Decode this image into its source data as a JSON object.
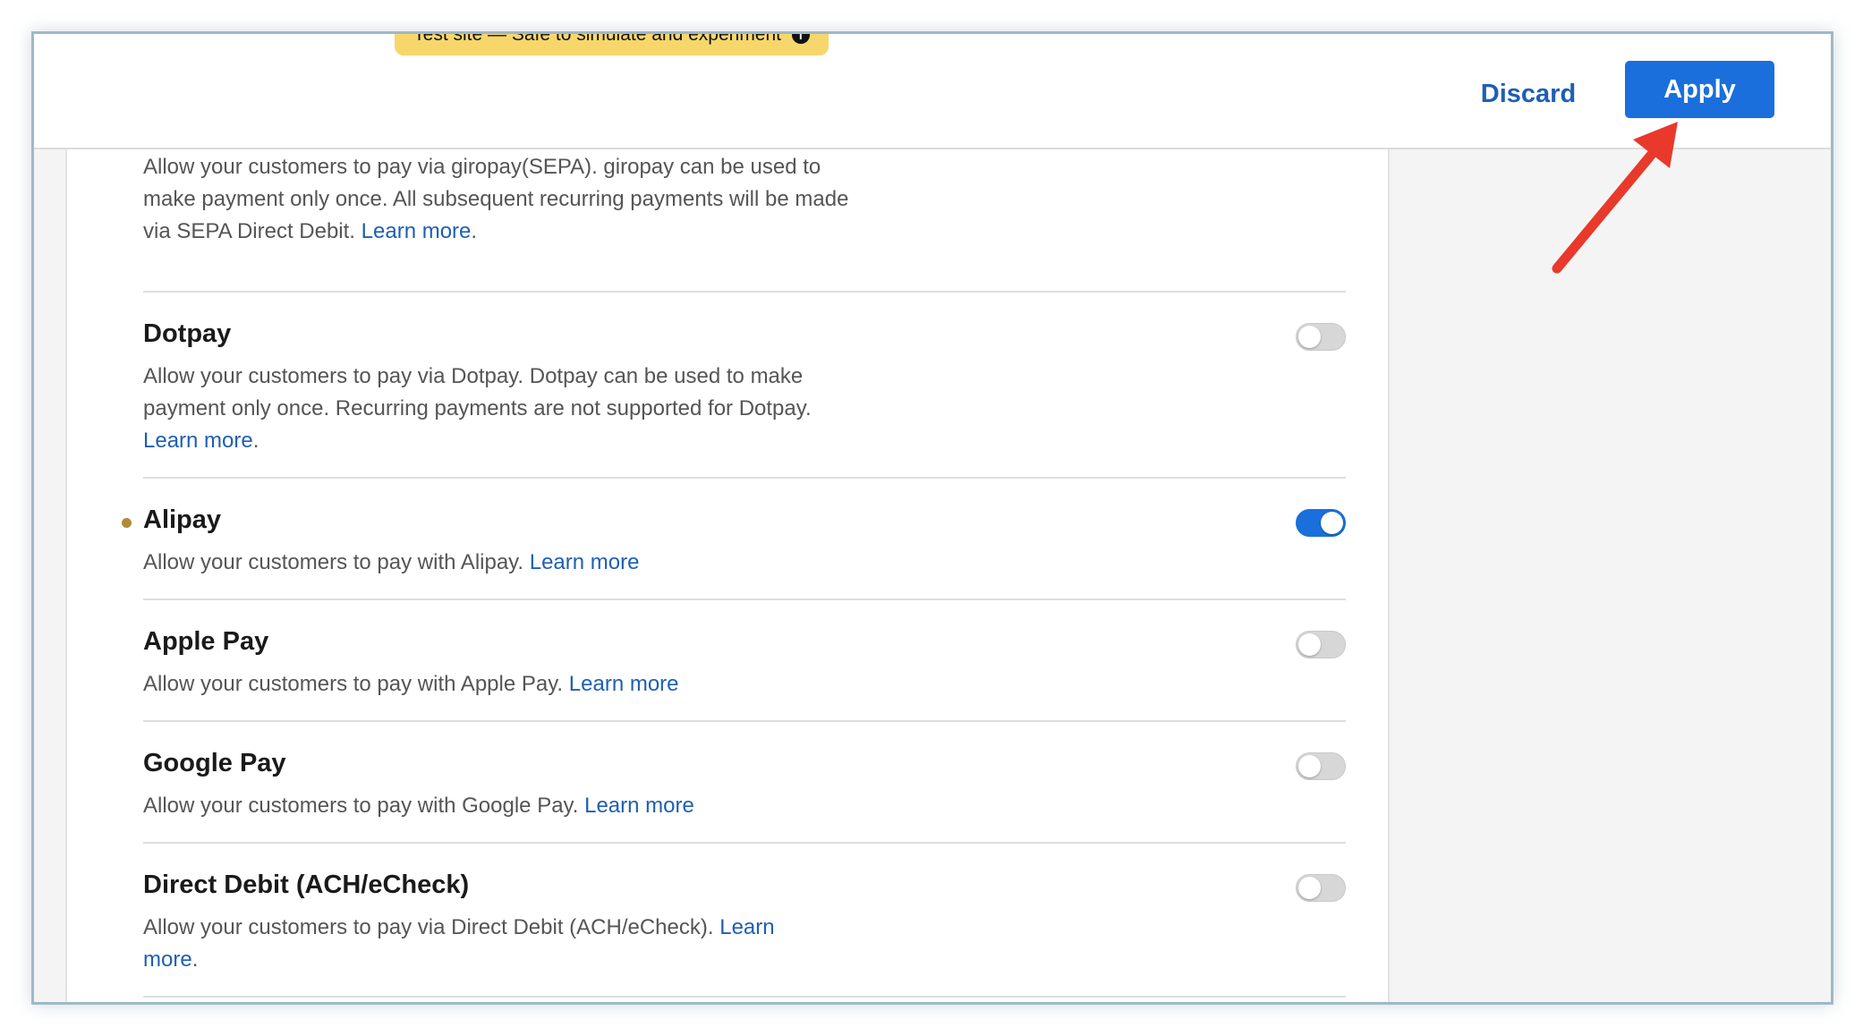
{
  "header": {
    "banner_text": "Test site — Safe to simulate and experiment",
    "banner_icon": "info-icon",
    "discard_label": "Discard",
    "apply_label": "Apply"
  },
  "colors": {
    "accent": "#1a6fdc",
    "link": "#1f5fb3",
    "banner": "#f7d76b",
    "arrow": "#e8392b"
  },
  "methods": [
    {
      "name": "",
      "desc": "Allow your customers to pay via giropay(SEPA). giropay can be used to make payment only once. All subsequent recurring payments will be made via SEPA Direct Debit.",
      "link": "Learn more",
      "link_suffix": ".",
      "enabled": null
    },
    {
      "name": "Dotpay",
      "desc": "Allow your customers to pay via Dotpay. Dotpay can be used to make payment only once. Recurring payments are not supported for Dotpay.",
      "link": "Learn more",
      "link_suffix": ".",
      "enabled": false
    },
    {
      "name": "Alipay",
      "desc": "Allow your customers to pay with Alipay.",
      "link": "Learn more",
      "link_suffix": "",
      "enabled": true
    },
    {
      "name": "Apple Pay",
      "desc": "Allow your customers to pay with Apple Pay.",
      "link": "Learn more",
      "link_suffix": "",
      "enabled": false
    },
    {
      "name": "Google Pay",
      "desc": "Allow your customers to pay with Google Pay.",
      "link": "Learn more",
      "link_suffix": "",
      "enabled": false
    },
    {
      "name": "Direct Debit (ACH/eCheck)",
      "desc": "Allow your customers to pay via Direct Debit (ACH/eCheck).",
      "link": "Learn more",
      "link_suffix": ".",
      "enabled": false
    }
  ]
}
